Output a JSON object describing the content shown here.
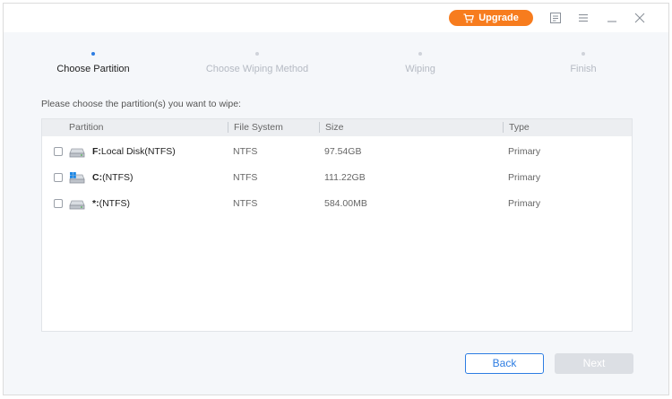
{
  "titlebar": {
    "upgrade_label": "Upgrade",
    "icons": [
      "cart-icon",
      "feedback-icon",
      "menu-icon",
      "minimize-icon",
      "close-icon"
    ]
  },
  "steps": [
    {
      "label": "Choose Partition",
      "active": true
    },
    {
      "label": "Choose Wiping Method",
      "active": false
    },
    {
      "label": "Wiping",
      "active": false
    },
    {
      "label": "Finish",
      "active": false
    }
  ],
  "prompt": "Please choose the partition(s) you want to wipe:",
  "table": {
    "headers": [
      "Partition",
      "File System",
      "Size",
      "Type"
    ],
    "rows": [
      {
        "letter": "F:",
        "name": "Local Disk(NTFS)",
        "fs": "NTFS",
        "size": "97.54GB",
        "type": "Primary",
        "icon": "disk-icon",
        "checked": false
      },
      {
        "letter": "C:",
        "name": "(NTFS)",
        "fs": "NTFS",
        "size": "111.22GB",
        "type": "Primary",
        "icon": "windows-disk-icon",
        "checked": false
      },
      {
        "letter": "*:",
        "name": "(NTFS)",
        "fs": "NTFS",
        "size": "584.00MB",
        "type": "Primary",
        "icon": "disk-icon",
        "checked": false
      }
    ]
  },
  "buttons": {
    "back": "Back",
    "next": "Next"
  },
  "colors": {
    "accent": "#2d7de2",
    "upgrade": "#f77c1e",
    "disabled": "#dcdfe4"
  }
}
